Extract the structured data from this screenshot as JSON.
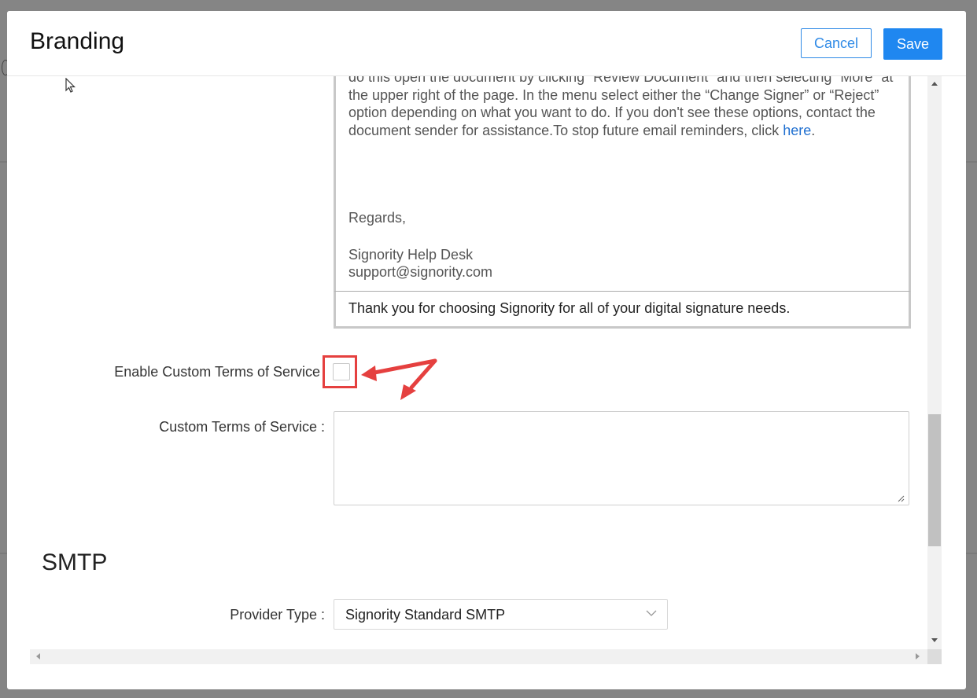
{
  "modal": {
    "title": "Branding",
    "cancel_label": "Cancel",
    "save_label": "Save"
  },
  "email_preview": {
    "body_line_1": "do this open the document by clicking “Review Document” and then selecting “More” at",
    "body_line_2": "the upper right of the page. In the menu select either the “Change Signer” or “Reject”",
    "body_line_3": "option depending on what you want to do. If you don't see these options, contact the",
    "body_line_4_prefix": "document sender for assistance.To stop future email reminders, click ",
    "body_link": "here",
    "body_line_4_suffix": ".",
    "regards": "Regards,",
    "signature_name": "Signority Help Desk",
    "signature_email": "support@signority.com",
    "footer": "Thank you for choosing Signority for all of your digital signature needs."
  },
  "terms": {
    "enable_label": "Enable Custom Terms of Service",
    "enable_checked": false,
    "custom_label": "Custom Terms of Service :",
    "custom_value": ""
  },
  "smtp": {
    "section_title": "SMTP",
    "provider_label": "Provider Type :",
    "provider_value": "Signority Standard SMTP"
  },
  "colors": {
    "primary": "#1f87f0",
    "annotation_red": "#e5403f"
  }
}
